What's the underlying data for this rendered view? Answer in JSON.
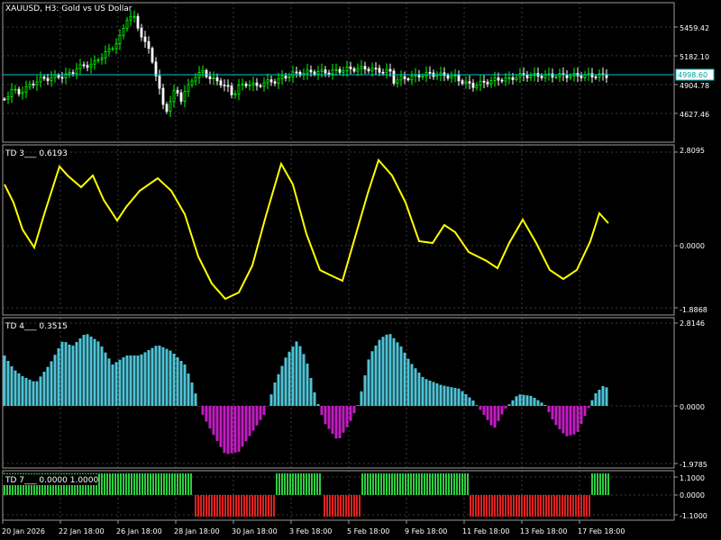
{
  "main": {
    "title": "XAUUSD, H3:  Gold vs US Dollar",
    "price_ticks": [
      "5459.42",
      "5182.10",
      "4904.78",
      "4627.46"
    ],
    "current_price": "4998.60",
    "colors": {
      "up": "#00ff00",
      "down": "#ffffff",
      "bid_line": "#00c8c8"
    },
    "current_value": 4998.6
  },
  "td3": {
    "title": "TD 3___  0.6193",
    "ticks": [
      "2.8095",
      "0.0000",
      "-1.8868"
    ],
    "color": "#ffff00"
  },
  "td4": {
    "title": "TD 4___  0.3515",
    "ticks": [
      "2.8146",
      "0.0000",
      "-1.9785"
    ],
    "colors": {
      "positive": "#4fc3d6",
      "negative": "#c21cc2"
    }
  },
  "td7": {
    "title": "TD 7___  0.0000  1.0000",
    "ticks": [
      "1.1000",
      "0.0000",
      "-1.1000"
    ],
    "colors": {
      "positive": "#2ecc40",
      "negative": "#e02020"
    }
  },
  "time_axis": {
    "labels": [
      "20 Jan 2026",
      "22 Jan 18:00",
      "26 Jan 18:00",
      "28 Jan 18:00",
      "30 Jan 18:00",
      "3 Feb 18:00",
      "5 Feb 18:00",
      "9 Feb 18:00",
      "11 Feb 18:00",
      "13 Feb 18:00",
      "17 Feb 18:00"
    ]
  }
}
